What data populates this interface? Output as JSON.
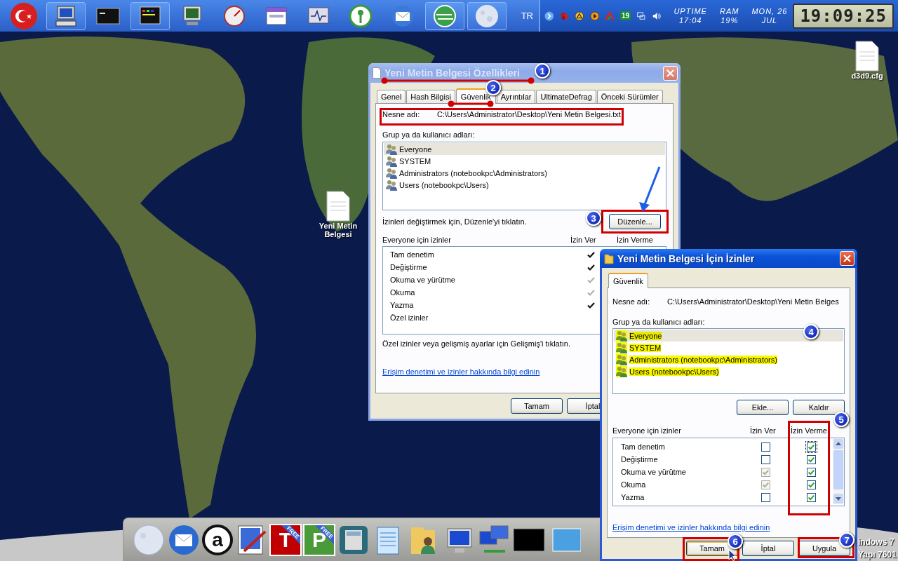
{
  "top_bar": {
    "launchers": [
      {
        "kind": "flag",
        "active": false
      },
      {
        "kind": "computer",
        "active": true
      },
      {
        "kind": "terminal",
        "active": false
      },
      {
        "kind": "screen",
        "active": true
      },
      {
        "kind": "monitor",
        "active": false
      },
      {
        "kind": "gauge",
        "active": false
      },
      {
        "kind": "window",
        "active": false
      },
      {
        "kind": "pulse",
        "active": false
      },
      {
        "kind": "key",
        "active": false
      },
      {
        "kind": "mail",
        "active": false
      },
      {
        "kind": "globe",
        "active": true
      },
      {
        "kind": "moon",
        "active": true
      }
    ],
    "language": "TR",
    "calendar_day": "19",
    "uptime_label": "UPTIME",
    "uptime": "17:04",
    "ram_label": "RAM",
    "ram": "19%",
    "date_day": "MON, 26",
    "date_month": "JUL",
    "clock": "19:09:25"
  },
  "desktop_icons": [
    {
      "label": "d3d9.cfg"
    },
    {
      "label": "Yeni Metin Belgesi"
    }
  ],
  "os_text": [
    "indows 7",
    "Yapı 7601"
  ],
  "dialog1": {
    "title": "Yeni Metin Belgesi Özellikleri",
    "active": false,
    "tabs": [
      {
        "label": "Genel",
        "selected": false
      },
      {
        "label": "Hash Bilgisi",
        "selected": false
      },
      {
        "label": "Güvenlik",
        "selected": true
      },
      {
        "label": "Ayrıntılar",
        "selected": false
      },
      {
        "label": "UltimateDefrag",
        "selected": false
      },
      {
        "label": "Önceki Sürümler",
        "selected": false
      }
    ],
    "object_label": "Nesne adı:",
    "object_path": "C:\\Users\\Administrator\\Desktop\\Yeni Metin Belgesi.txt",
    "groups_label": "Grup ya da kullanıcı adları:",
    "groups": [
      {
        "name": "Everyone",
        "selected": true
      },
      {
        "name": "SYSTEM",
        "selected": false
      },
      {
        "name": "Administrators (notebookpc\\Administrators)",
        "selected": false
      },
      {
        "name": "Users (notebookpc\\Users)",
        "selected": false
      }
    ],
    "edit_hint": "İzinleri değiştirmek için, Düzenle'yi tıklatın.",
    "edit_button": "Düzenle...",
    "permissions_label": "Everyone için izinler",
    "allow_header": "İzin Ver",
    "deny_header": "İzin Verme",
    "permissions": [
      {
        "name": "Tam denetim",
        "allow": true,
        "inherited": false
      },
      {
        "name": "Değiştirme",
        "allow": true,
        "inherited": false
      },
      {
        "name": "Okuma ve yürütme",
        "allow": true,
        "inherited": true
      },
      {
        "name": "Okuma",
        "allow": true,
        "inherited": true
      },
      {
        "name": "Yazma",
        "allow": true,
        "inherited": false
      },
      {
        "name": "Özel izinler",
        "allow": false
      }
    ],
    "advanced_hint": "Özel izinler veya gelişmiş ayarlar için Gelişmiş'i tıklatın.",
    "link": "Erişim denetimi ve izinler hakkında bilgi edinin",
    "buttons": [
      "Tamam",
      "İptal"
    ]
  },
  "dialog2": {
    "title": "Yeni Metin Belgesi İçin İzinler",
    "active": true,
    "tabs": [
      {
        "label": "Güvenlik",
        "selected": true
      }
    ],
    "object_label": "Nesne adı:",
    "object_path": "C:\\Users\\Administrator\\Desktop\\Yeni Metin Belges",
    "groups_label": "Grup ya da kullanıcı adları:",
    "groups": [
      {
        "name": "Everyone",
        "selected": true,
        "highlighted": true
      },
      {
        "name": "SYSTEM",
        "selected": false,
        "highlighted": true
      },
      {
        "name": "Administrators (notebookpc\\Administrators)",
        "selected": false,
        "highlighted": true
      },
      {
        "name": "Users (notebookpc\\Users)",
        "selected": false,
        "highlighted": true
      }
    ],
    "add_button": "Ekle...",
    "remove_button": "Kaldır",
    "permissions_label": "Everyone için izinler",
    "allow_header": "İzin Ver",
    "deny_header": "İzin Verme",
    "permissions": [
      {
        "name": "Tam denetim",
        "allow": false,
        "allow_disabled": false,
        "deny": true,
        "focused": true
      },
      {
        "name": "Değiştirme",
        "allow": false,
        "allow_disabled": false,
        "deny": true,
        "focused": false
      },
      {
        "name": "Okuma ve yürütme",
        "allow": true,
        "allow_disabled": true,
        "deny": true,
        "focused": false
      },
      {
        "name": "Okuma",
        "allow": true,
        "allow_disabled": true,
        "deny": true,
        "focused": false
      },
      {
        "name": "Yazma",
        "allow": false,
        "allow_disabled": false,
        "deny": true,
        "focused": false
      }
    ],
    "link": "Erişim denetimi ve izinler hakkında bilgi edinin",
    "buttons": [
      {
        "label": "Tamam",
        "default": true
      },
      {
        "label": "İptal",
        "default": false
      },
      {
        "label": "Uygula",
        "default": false
      }
    ]
  },
  "dock": [
    {
      "kind": "moon"
    },
    {
      "kind": "mail"
    },
    {
      "kind": "letter",
      "letter": "a"
    },
    {
      "kind": "paint"
    },
    {
      "kind": "free",
      "letter": "T",
      "badge": "FREE",
      "color": "#c00000"
    },
    {
      "kind": "free",
      "letter": "P",
      "badge": "FREE",
      "color": "#4a9a3a"
    },
    {
      "kind": "calculator"
    },
    {
      "kind": "notepad"
    },
    {
      "kind": "user-folder"
    },
    {
      "kind": "computer"
    },
    {
      "kind": "network"
    },
    {
      "kind": "terminal"
    },
    {
      "kind": "window"
    }
  ],
  "annotations": [
    {
      "label": "1"
    },
    {
      "label": "2"
    },
    {
      "label": "3"
    },
    {
      "label": "4"
    },
    {
      "label": "5"
    },
    {
      "label": "6"
    },
    {
      "label": "7"
    }
  ]
}
